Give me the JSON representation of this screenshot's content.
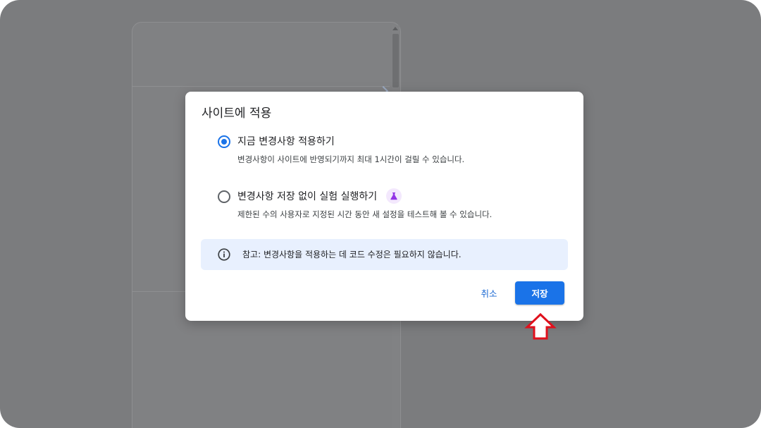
{
  "dialog": {
    "title": "사이트에 적용",
    "options": [
      {
        "label": "지금 변경사항 적용하기",
        "description": "변경사항이 사이트에 반영되기까지 최대 1시간이 걸릴 수 있습니다.",
        "selected": true
      },
      {
        "label": "변경사항 저장 없이 실험 실행하기",
        "description": "제한된 수의 사용자로 지정된 시간 동안 새 설정을 테스트해 볼 수 있습니다.",
        "selected": false,
        "badge_icon": "flask-icon"
      }
    ],
    "info": {
      "icon": "info-icon",
      "text": "참고: 변경사항을 적용하는 데 코드 수정은 필요하지 않습니다."
    },
    "cancel_label": "취소",
    "save_label": "저장"
  },
  "colors": {
    "accent": "#1a73e8",
    "overlay": "#7b7c7e",
    "info_bg": "#e8f0fe",
    "badge_bg": "#f3e8fd",
    "badge_icon": "#9334e6",
    "pointer_arrow": "#e0101c"
  }
}
